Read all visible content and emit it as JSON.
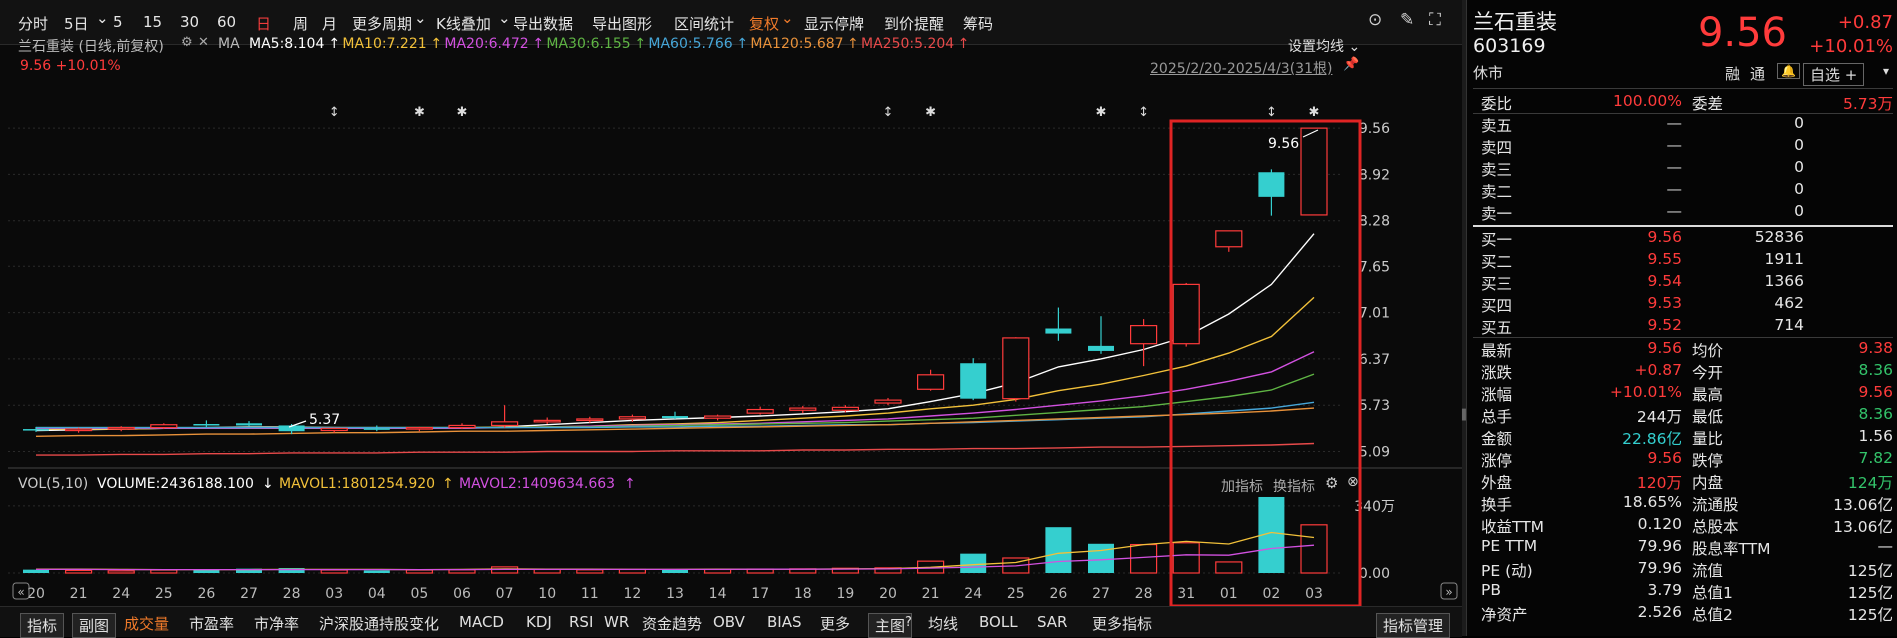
{
  "toolbar": {
    "items": [
      "分时",
      "5日",
      "5",
      "15",
      "30",
      "60",
      "日",
      "周",
      "月",
      "更多周期",
      "K线叠加",
      "导出数据",
      "导出图形",
      "区间统计",
      "复权",
      "显示停牌",
      "到价提醒",
      "筹码"
    ],
    "active": "日"
  },
  "chart_title": "兰石重装 (日线,前复权)",
  "ma_label": "MA",
  "ma_values": [
    {
      "text": "MA5:8.104",
      "color": "#ffffff"
    },
    {
      "text": "MA10:7.221",
      "color": "#f2c13a"
    },
    {
      "text": "MA20:6.472",
      "color": "#d251e0"
    },
    {
      "text": "MA30:6.155",
      "color": "#5fb544"
    },
    {
      "text": "MA60:5.766",
      "color": "#46a6d8"
    },
    {
      "text": "MA120:5.687",
      "color": "#e8913a"
    },
    {
      "text": "MA250:5.204",
      "color": "#e84a4a"
    }
  ],
  "set_ma": "设置均线",
  "price_line": "9.56 +10.01%",
  "date_range": "2025/2/20-2025/4/3(31根)",
  "volume_legend": {
    "label": "VOL(5,10)",
    "volume": "VOLUME:2436188.100",
    "mavol1": "MAVOL1:1801254.920",
    "mavol2": "MAVOL2:1409634.663"
  },
  "indicator_links": {
    "add": "加指标",
    "swap": "换指标"
  },
  "annotations": {
    "high_label": "9.56",
    "low_label": "5.37"
  },
  "chart_data": {
    "type": "candlestick",
    "dates": [
      "20",
      "21",
      "24",
      "25",
      "26",
      "27",
      "28",
      "03",
      "04",
      "05",
      "06",
      "07",
      "10",
      "11",
      "12",
      "13",
      "14",
      "17",
      "18",
      "19",
      "20",
      "21",
      "24",
      "25",
      "26",
      "27",
      "28",
      "31",
      "01",
      "02",
      "03"
    ],
    "ohlc": [
      [
        5.4,
        5.43,
        5.36,
        5.38
      ],
      [
        5.38,
        5.42,
        5.35,
        5.4
      ],
      [
        5.4,
        5.44,
        5.37,
        5.42
      ],
      [
        5.42,
        5.48,
        5.4,
        5.46
      ],
      [
        5.47,
        5.52,
        5.43,
        5.45
      ],
      [
        5.48,
        5.51,
        5.44,
        5.45
      ],
      [
        5.45,
        5.47,
        5.33,
        5.37
      ],
      [
        5.38,
        5.42,
        5.35,
        5.41
      ],
      [
        5.41,
        5.45,
        5.37,
        5.39
      ],
      [
        5.4,
        5.43,
        5.37,
        5.42
      ],
      [
        5.42,
        5.48,
        5.4,
        5.45
      ],
      [
        5.45,
        5.73,
        5.42,
        5.5
      ],
      [
        5.5,
        5.56,
        5.47,
        5.52
      ],
      [
        5.52,
        5.57,
        5.49,
        5.54
      ],
      [
        5.54,
        5.6,
        5.5,
        5.57
      ],
      [
        5.58,
        5.64,
        5.54,
        5.55
      ],
      [
        5.55,
        5.6,
        5.52,
        5.58
      ],
      [
        5.62,
        5.71,
        5.6,
        5.67
      ],
      [
        5.66,
        5.72,
        5.62,
        5.69
      ],
      [
        5.66,
        5.73,
        5.63,
        5.7
      ],
      [
        5.76,
        5.83,
        5.73,
        5.8
      ],
      [
        5.95,
        6.22,
        5.93,
        6.15
      ],
      [
        6.31,
        6.38,
        5.8,
        5.82
      ],
      [
        5.82,
        6.67,
        5.78,
        6.66
      ],
      [
        6.79,
        7.08,
        6.62,
        6.72
      ],
      [
        6.55,
        6.96,
        6.44,
        6.48
      ],
      [
        6.58,
        6.92,
        6.27,
        6.83
      ],
      [
        6.58,
        7.42,
        6.54,
        7.4
      ],
      [
        7.92,
        8.14,
        7.85,
        8.14
      ],
      [
        8.95,
        8.99,
        8.35,
        8.61
      ],
      [
        8.36,
        9.56,
        8.36,
        9.56
      ]
    ],
    "ma": [
      {
        "name": "MA5",
        "color": "#ffffff",
        "values": [
          5.38,
          5.39,
          5.4,
          5.41,
          5.42,
          5.43,
          5.43,
          5.42,
          5.41,
          5.41,
          5.41,
          5.43,
          5.46,
          5.49,
          5.52,
          5.54,
          5.56,
          5.58,
          5.61,
          5.64,
          5.68,
          5.78,
          5.89,
          6.04,
          6.26,
          6.37,
          6.5,
          6.68,
          6.99,
          7.4,
          8.1
        ]
      },
      {
        "name": "MA10",
        "color": "#f2c13a",
        "values": [
          5.4,
          5.4,
          5.4,
          5.41,
          5.41,
          5.42,
          5.42,
          5.42,
          5.42,
          5.42,
          5.42,
          5.43,
          5.43,
          5.44,
          5.46,
          5.47,
          5.49,
          5.52,
          5.55,
          5.58,
          5.62,
          5.68,
          5.73,
          5.81,
          5.93,
          6.02,
          6.14,
          6.27,
          6.45,
          6.68,
          7.22
        ]
      },
      {
        "name": "MA20",
        "color": "#d251e0",
        "values": [
          5.41,
          5.41,
          5.41,
          5.41,
          5.41,
          5.41,
          5.41,
          5.41,
          5.41,
          5.41,
          5.41,
          5.42,
          5.43,
          5.44,
          5.45,
          5.46,
          5.47,
          5.48,
          5.5,
          5.52,
          5.54,
          5.58,
          5.62,
          5.67,
          5.73,
          5.79,
          5.86,
          5.95,
          6.06,
          6.19,
          6.47
        ]
      },
      {
        "name": "MA30",
        "color": "#5fb544",
        "values": [
          5.42,
          5.42,
          5.42,
          5.42,
          5.42,
          5.42,
          5.42,
          5.42,
          5.42,
          5.42,
          5.42,
          5.42,
          5.43,
          5.43,
          5.44,
          5.45,
          5.46,
          5.47,
          5.48,
          5.49,
          5.51,
          5.53,
          5.55,
          5.59,
          5.63,
          5.67,
          5.71,
          5.78,
          5.85,
          5.94,
          6.16
        ]
      },
      {
        "name": "MA60",
        "color": "#46a6d8",
        "values": [
          5.42,
          5.42,
          5.42,
          5.42,
          5.42,
          5.42,
          5.42,
          5.42,
          5.42,
          5.42,
          5.42,
          5.42,
          5.42,
          5.42,
          5.43,
          5.43,
          5.44,
          5.44,
          5.45,
          5.46,
          5.46,
          5.48,
          5.49,
          5.51,
          5.53,
          5.55,
          5.57,
          5.61,
          5.65,
          5.69,
          5.77
        ]
      },
      {
        "name": "MA120",
        "color": "#e8913a",
        "values": [
          5.3,
          5.31,
          5.31,
          5.32,
          5.33,
          5.33,
          5.34,
          5.35,
          5.35,
          5.36,
          5.37,
          5.37,
          5.38,
          5.39,
          5.4,
          5.41,
          5.42,
          5.43,
          5.44,
          5.45,
          5.46,
          5.48,
          5.5,
          5.52,
          5.54,
          5.56,
          5.58,
          5.6,
          5.62,
          5.65,
          5.69
        ]
      },
      {
        "name": "MA250",
        "color": "#e84a4a",
        "values": [
          5.04,
          5.04,
          5.05,
          5.05,
          5.06,
          5.06,
          5.07,
          5.07,
          5.07,
          5.08,
          5.08,
          5.08,
          5.09,
          5.09,
          5.09,
          5.1,
          5.1,
          5.1,
          5.11,
          5.11,
          5.12,
          5.12,
          5.13,
          5.13,
          5.14,
          5.15,
          5.15,
          5.16,
          5.17,
          5.18,
          5.2
        ]
      }
    ],
    "volume": [
      0.17,
      0.13,
      0.11,
      0.15,
      0.2,
      0.22,
      0.25,
      0.15,
      0.13,
      0.15,
      0.16,
      0.31,
      0.18,
      0.16,
      0.18,
      0.2,
      0.18,
      0.2,
      0.21,
      0.24,
      0.26,
      0.6,
      0.98,
      0.76,
      2.32,
      1.48,
      1.44,
      1.53,
      0.56,
      3.85,
      2.44
    ],
    "volume_unit": "百万",
    "mavol1": [
      0.2,
      0.19,
      0.18,
      0.17,
      0.17,
      0.17,
      0.18,
      0.18,
      0.18,
      0.17,
      0.18,
      0.21,
      0.2,
      0.19,
      0.18,
      0.18,
      0.19,
      0.19,
      0.2,
      0.21,
      0.22,
      0.29,
      0.42,
      0.53,
      1.0,
      1.14,
      1.44,
      1.6,
      1.47,
      2.05,
      1.8
    ],
    "mavol2": [
      0.18,
      0.18,
      0.17,
      0.17,
      0.17,
      0.17,
      0.17,
      0.17,
      0.17,
      0.17,
      0.17,
      0.18,
      0.18,
      0.18,
      0.18,
      0.18,
      0.18,
      0.19,
      0.19,
      0.2,
      0.21,
      0.25,
      0.3,
      0.36,
      0.58,
      0.67,
      0.79,
      0.92,
      0.9,
      1.24,
      1.41
    ],
    "y_ticks": [
      "9.56",
      "8.92",
      "8.28",
      "7.65",
      "7.01",
      "6.37",
      "5.73",
      "5.09"
    ],
    "vol_ticks": [
      "340万",
      "0.00"
    ],
    "ylim": [
      5.0,
      9.7
    ],
    "vol_max": 3.95,
    "markers": [
      {
        "i": 7,
        "sym": "↕"
      },
      {
        "i": 9,
        "sym": "✱"
      },
      {
        "i": 10,
        "sym": "✱"
      },
      {
        "i": 20,
        "sym": "↕"
      },
      {
        "i": 21,
        "sym": "✱"
      },
      {
        "i": 25,
        "sym": "✱"
      },
      {
        "i": 26,
        "sym": "↕"
      },
      {
        "i": 29,
        "sym": "↕"
      },
      {
        "i": 30,
        "sym": "✱"
      }
    ]
  },
  "bottom_tabs": [
    "指标",
    "副图",
    "成交量",
    "市盈率",
    "市净率",
    "沪深股通持股变化",
    "MACD",
    "KDJ",
    "RSI",
    "WR",
    "资金趋势",
    "OBV",
    "BIAS",
    "更多",
    "主图",
    "均线",
    "BOLL",
    "SAR",
    "更多指标"
  ],
  "bottom_active": "成交量",
  "bottom_right": "指标管理",
  "quote": {
    "name": "兰石重装",
    "code": "603169",
    "status": "休市",
    "price": "9.56",
    "change": "+0.87",
    "pct": "+10.01%",
    "tags": [
      "融",
      "通"
    ],
    "watch": "自选 +",
    "weibi_label": "委比",
    "weibi": "100.00%",
    "weicha_label": "委差",
    "weicha": "5.73万",
    "sell": [
      [
        "卖五",
        "—",
        "0"
      ],
      [
        "卖四",
        "—",
        "0"
      ],
      [
        "卖三",
        "—",
        "0"
      ],
      [
        "卖二",
        "—",
        "0"
      ],
      [
        "卖一",
        "—",
        "0"
      ]
    ],
    "buy": [
      [
        "买一",
        "9.56",
        "52836"
      ],
      [
        "买二",
        "9.55",
        "1911"
      ],
      [
        "买三",
        "9.54",
        "1366"
      ],
      [
        "买四",
        "9.53",
        "462"
      ],
      [
        "买五",
        "9.52",
        "714"
      ]
    ],
    "stats": [
      [
        "最新",
        "9.56",
        "red",
        "均价",
        "9.38",
        "red"
      ],
      [
        "涨跌",
        "+0.87",
        "red",
        "今开",
        "8.36",
        "green"
      ],
      [
        "涨幅",
        "+10.01%",
        "red",
        "最高",
        "9.56",
        "red"
      ],
      [
        "总手",
        "244万",
        "white",
        "最低",
        "8.36",
        "green"
      ],
      [
        "金额",
        "22.86亿",
        "teal",
        "量比",
        "1.56",
        "white"
      ],
      [
        "涨停",
        "9.56",
        "red",
        "跌停",
        "7.82",
        "green"
      ],
      [
        "外盘",
        "120万",
        "red",
        "内盘",
        "124万",
        "green"
      ],
      [
        "换手",
        "18.65%",
        "white",
        "流通股",
        "13.06亿",
        "white"
      ],
      [
        "收益TTM",
        "0.120",
        "white",
        "总股本",
        "13.06亿",
        "white"
      ],
      [
        "PE TTM",
        "79.96",
        "white",
        "股息率TTM",
        "—",
        "white"
      ],
      [
        "PE (动)",
        "79.96",
        "white",
        "流值",
        "125亿",
        "white"
      ],
      [
        "PB",
        "3.79",
        "white",
        "总值1",
        "125亿",
        "white"
      ],
      [
        "净资产",
        "2.526",
        "white",
        "总值2",
        "125亿",
        "white"
      ]
    ]
  }
}
